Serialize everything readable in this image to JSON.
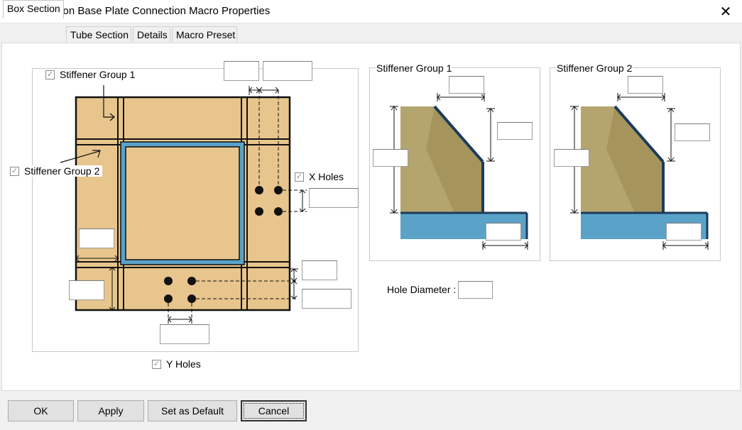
{
  "window": {
    "title": "Hollow Section Base Plate Connection Macro Properties",
    "close_glyph": "✕"
  },
  "tabs": [
    {
      "label": "Box Section",
      "active": true
    },
    {
      "label": "Tube Section",
      "active": false
    },
    {
      "label": "Details",
      "active": false
    },
    {
      "label": "Macro Preset",
      "active": false
    }
  ],
  "box_section": {
    "stiffener_group_1": {
      "label": "Stiffener Group 1",
      "checked": true
    },
    "stiffener_group_2": {
      "label": "Stiffener Group 2",
      "checked": true
    },
    "x_holes": {
      "label": "X Holes",
      "checked": true
    },
    "y_holes": {
      "label": "Y Holes",
      "checked": true
    },
    "fields": {
      "plate_dim_1": "",
      "plate_dim_2": "",
      "x_hole_spacing": "",
      "stiffener_edge": "",
      "plate_edge": "",
      "y_edge_1": "",
      "y_edge_2": "",
      "y_hole_spacing": ""
    }
  },
  "stiffener_panels": [
    {
      "title": "Stiffener Group 1",
      "fields": {
        "width": "",
        "height": "",
        "side": "",
        "offset": ""
      }
    },
    {
      "title": "Stiffener Group 2",
      "fields": {
        "width": "",
        "height": "",
        "side": "",
        "offset": ""
      }
    }
  ],
  "hole_diameter": {
    "label": "Hole Diameter :",
    "value": ""
  },
  "colors": {
    "plate": "#e7c58c",
    "tube": "#5aa2c8",
    "stiffener_dark": "#8c7743",
    "stiffener_light": "#d0c694"
  },
  "buttons": {
    "ok": "OK",
    "apply": "Apply",
    "set_default": "Set as Default",
    "cancel": "Cancel"
  }
}
